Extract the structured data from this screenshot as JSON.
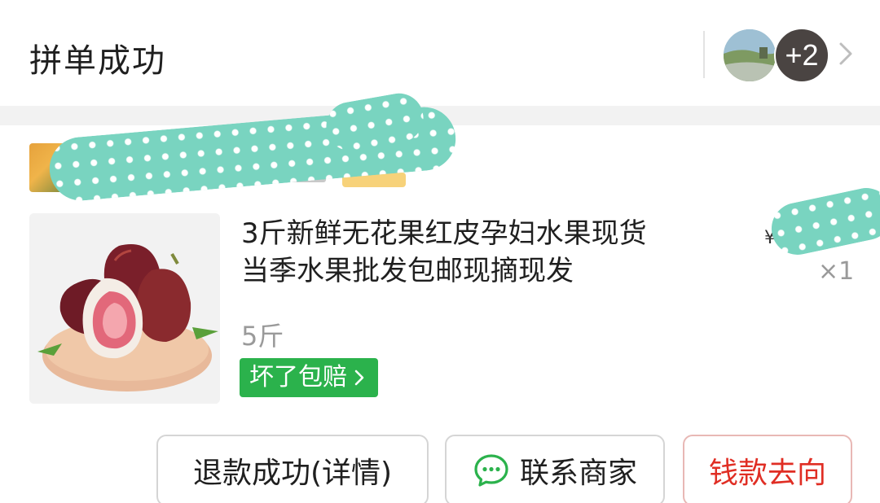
{
  "header": {
    "title": "拼单成功",
    "avatars": {
      "extra_count": "+2"
    }
  },
  "product": {
    "name_line1": "3斤新鲜无花果红皮孕妇水果现货",
    "name_line2": "当季水果批发包邮现摘现发",
    "price_symbol": "¥",
    "quantity": "×1",
    "spec": "5斤",
    "guarantee_badge": "坏了包赔"
  },
  "actions": {
    "refund": "退款成功(详情)",
    "contact": "联系商家",
    "money_flow": "钱款去向"
  },
  "colors": {
    "green": "#2bb24c",
    "accent_red": "#e02e24",
    "redaction": "#79d4c0"
  }
}
